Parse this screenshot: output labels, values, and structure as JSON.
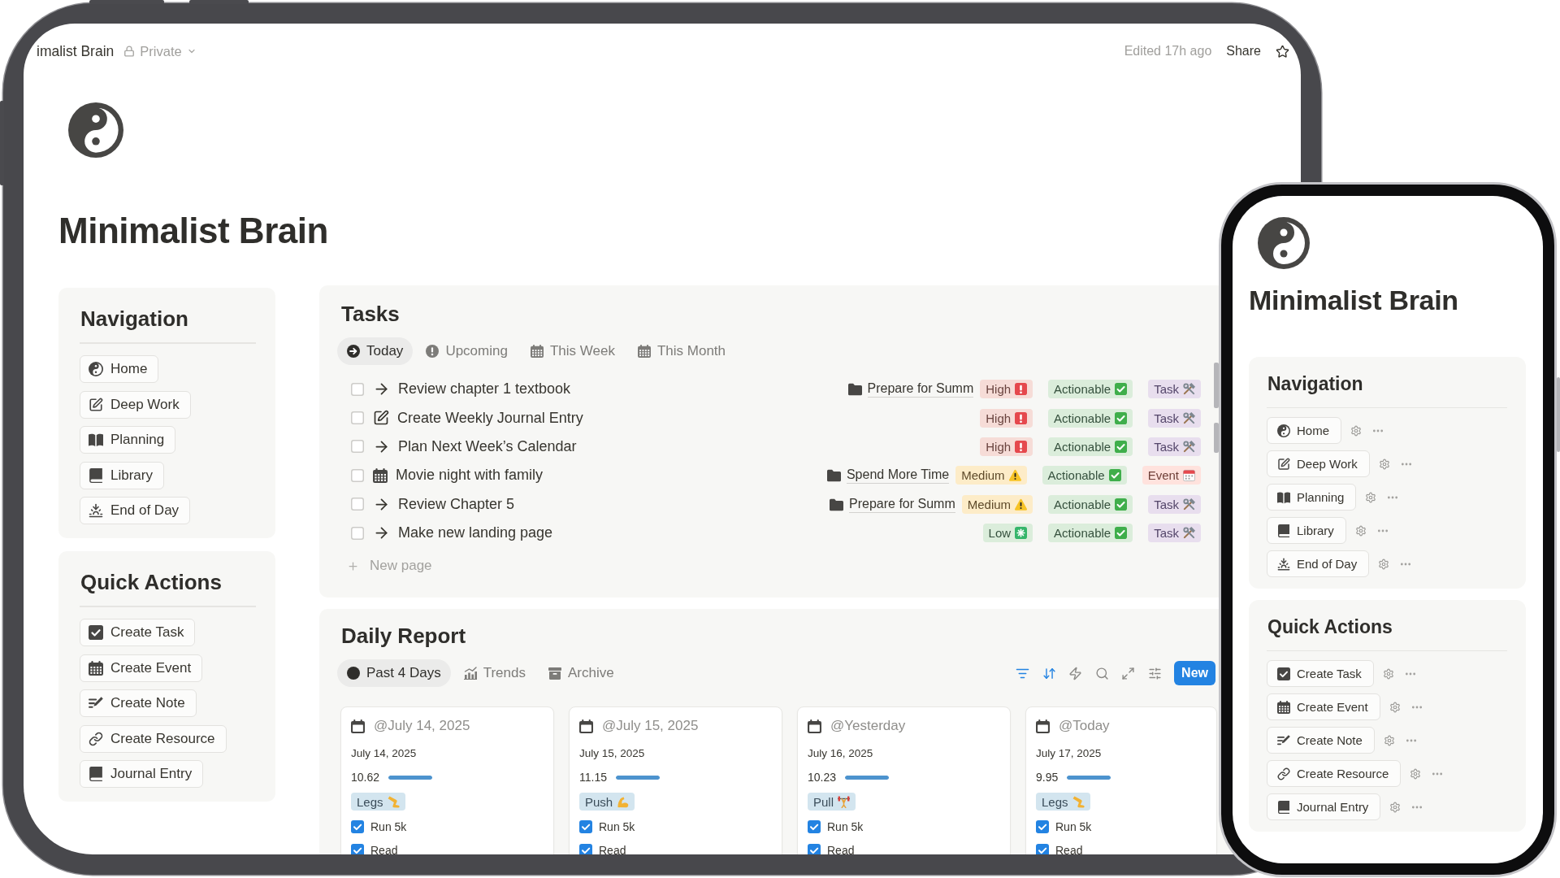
{
  "tablet": {
    "topbar": {
      "breadcrumb": "imalist Brain",
      "visibility": "Private",
      "edited": "Edited 17h ago",
      "share": "Share",
      "favorited": false
    },
    "title": "Minimalist Brain",
    "navigation": {
      "heading": "Navigation",
      "items": [
        {
          "label": "Home",
          "kind": "home"
        },
        {
          "label": "Deep Work",
          "kind": "focus"
        },
        {
          "label": "Planning",
          "kind": "planning"
        },
        {
          "label": "Library",
          "kind": "library"
        },
        {
          "label": "End of Day",
          "kind": "review"
        }
      ]
    },
    "quick_actions": {
      "heading": "Quick Actions",
      "items": [
        {
          "label": "Create Task",
          "kind": "task"
        },
        {
          "label": "Create Event",
          "kind": "event"
        },
        {
          "label": "Create Note",
          "kind": "note"
        },
        {
          "label": "Create Resource",
          "kind": "resource"
        },
        {
          "label": "Journal Entry",
          "kind": "journal"
        }
      ]
    },
    "tasks": {
      "heading": "Tasks",
      "tabs": [
        {
          "label": "Today",
          "kind": "today",
          "selected": true
        },
        {
          "label": "Upcoming",
          "kind": "upcoming",
          "selected": false
        },
        {
          "label": "This Week",
          "kind": "week",
          "selected": false
        },
        {
          "label": "This Month",
          "kind": "month",
          "selected": false
        }
      ],
      "rows": [
        {
          "title": "Review chapter 1 textbook",
          "kind": "task",
          "checked": false,
          "project": "Prepare for Summ",
          "tags": [
            {
              "text": "High",
              "kind": "high",
              "color": "#f6dcd7"
            },
            {
              "text": "Actionable",
              "kind": "actionable",
              "color": "#dbeddb"
            },
            {
              "text": "Task",
              "kind": "task",
              "color": "#e8deee"
            }
          ]
        },
        {
          "title": "Create Weekly Journal Entry",
          "kind": "journal",
          "checked": false,
          "tags": [
            {
              "text": "High",
              "kind": "high",
              "color": "#f6dcd7"
            },
            {
              "text": "Actionable",
              "kind": "actionable",
              "color": "#dbeddb"
            },
            {
              "text": "Task",
              "kind": "task",
              "color": "#e8deee"
            }
          ]
        },
        {
          "title": "Plan Next Week’s Calendar",
          "kind": "task",
          "checked": false,
          "tags": [
            {
              "text": "High",
              "kind": "high",
              "color": "#f6dcd7"
            },
            {
              "text": "Actionable",
              "kind": "actionable",
              "color": "#dbeddb"
            },
            {
              "text": "Task",
              "kind": "task",
              "color": "#e8deee"
            }
          ]
        },
        {
          "title": "Movie night with family",
          "kind": "event",
          "checked": false,
          "project": "Spend More Time",
          "tags": [
            {
              "text": "Medium",
              "kind": "medium",
              "color": "#fdecc8"
            },
            {
              "text": "Actionable",
              "kind": "actionable",
              "color": "#dbeddb"
            },
            {
              "text": "Event",
              "kind": "event",
              "color": "#ffe2dd"
            }
          ]
        },
        {
          "title": "Review Chapter 5",
          "kind": "task",
          "checked": false,
          "project": "Prepare for Summ",
          "tags": [
            {
              "text": "Medium",
              "kind": "medium",
              "color": "#fdecc8"
            },
            {
              "text": "Actionable",
              "kind": "actionable",
              "color": "#dbeddb"
            },
            {
              "text": "Task",
              "kind": "task",
              "color": "#e8deee"
            }
          ]
        },
        {
          "title": "Make new landing page",
          "kind": "task",
          "checked": false,
          "tags": [
            {
              "text": "Low",
              "kind": "low",
              "color": "#dbeddb"
            },
            {
              "text": "Actionable",
              "kind": "actionable",
              "color": "#dbeddb"
            },
            {
              "text": "Task",
              "kind": "task",
              "color": "#e8deee"
            }
          ]
        }
      ],
      "new_page": "New page"
    },
    "daily_report": {
      "heading": "Daily Report",
      "tabs": [
        {
          "label": "Past 4 Days",
          "kind": "gallery",
          "selected": true
        },
        {
          "label": "Trends",
          "kind": "chart",
          "selected": false
        },
        {
          "label": "Archive",
          "kind": "archive",
          "selected": false
        }
      ],
      "tools": [
        {
          "kind": "filter",
          "active": true
        },
        {
          "kind": "sort",
          "active": true
        },
        {
          "kind": "automation",
          "active": false
        },
        {
          "kind": "search",
          "active": false
        },
        {
          "kind": "expand",
          "active": false
        },
        {
          "kind": "settings",
          "active": false
        }
      ],
      "new_button": "New",
      "cards": [
        {
          "title": "@July 14, 2025",
          "date": "July 14, 2025",
          "value": "10.62",
          "level": 1,
          "tag": {
            "text": "Legs",
            "kind": "legs"
          },
          "checklist": [
            {
              "label": "Run 5k",
              "checked": true
            },
            {
              "label": "Read",
              "checked": true
            }
          ]
        },
        {
          "title": "@July 15, 2025",
          "date": "July 15, 2025",
          "value": "11.15",
          "level": 1,
          "tag": {
            "text": "Push",
            "kind": "push"
          },
          "checklist": [
            {
              "label": "Run 5k",
              "checked": true
            },
            {
              "label": "Read",
              "checked": true
            }
          ]
        },
        {
          "title": "@Yesterday",
          "date": "July 16, 2025",
          "value": "10.23",
          "level": 1,
          "tag": {
            "text": "Pull",
            "kind": "pull"
          },
          "checklist": [
            {
              "label": "Run 5k",
              "checked": true
            },
            {
              "label": "Read",
              "checked": true
            }
          ]
        },
        {
          "title": "@Today",
          "date": "July 17, 2025",
          "value": "9.95",
          "level": 1,
          "tag": {
            "text": "Legs",
            "kind": "legs"
          },
          "checklist": [
            {
              "label": "Run 5k",
              "checked": true
            },
            {
              "label": "Read",
              "checked": true
            }
          ]
        }
      ]
    }
  },
  "phone": {
    "title": "Minimalist Brain",
    "navigation": {
      "heading": "Navigation",
      "items": [
        {
          "label": "Home",
          "kind": "home"
        },
        {
          "label": "Deep Work",
          "kind": "focus"
        },
        {
          "label": "Planning",
          "kind": "planning"
        },
        {
          "label": "Library",
          "kind": "library"
        },
        {
          "label": "End of Day",
          "kind": "review"
        }
      ]
    },
    "quick_actions": {
      "heading": "Quick Actions",
      "items": [
        {
          "label": "Create Task",
          "kind": "task"
        },
        {
          "label": "Create Event",
          "kind": "event"
        },
        {
          "label": "Create Note",
          "kind": "note"
        },
        {
          "label": "Create Resource",
          "kind": "resource"
        },
        {
          "label": "Journal Entry",
          "kind": "journal"
        }
      ]
    }
  }
}
